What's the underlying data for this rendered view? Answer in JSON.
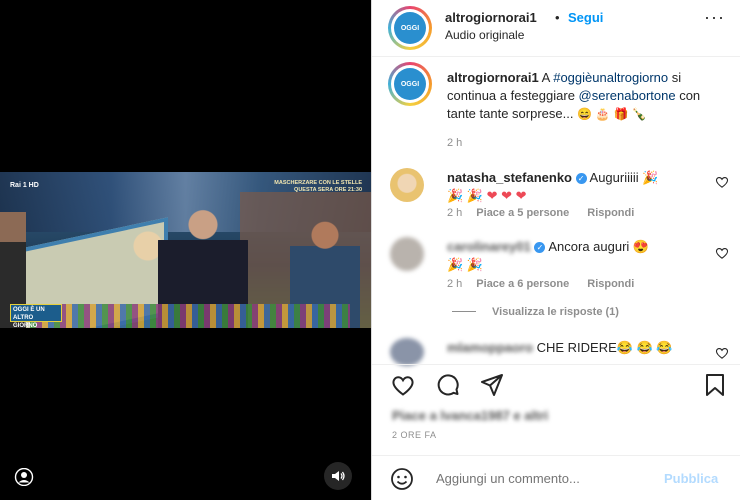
{
  "media": {
    "channel_label": "Rai 1 HD",
    "ticker_text": "MASCHERZARE CON LE STELLE QUESTA SERA ORE 21:30",
    "show_logo": "OGGI È UN ALTRO GIORNO",
    "icons": {
      "user": "user-tag-icon",
      "audio": "speaker-icon"
    }
  },
  "header": {
    "username": "altrogiornorai1",
    "separator": "•",
    "follow_label": "Segui",
    "subtitle": "Audio originale",
    "more_icon": "more-options-icon"
  },
  "caption": {
    "username": "altrogiornorai1",
    "text_a": " A ",
    "hashtag": "#oggièunaltrogiorno",
    "text_b": " si continua a festeggiare ",
    "mention": "@serenabortone",
    "text_c": " con tante tante sorprese... ",
    "emojis": "😄 🎂 🎁 🍾",
    "time": "2 h"
  },
  "comments": [
    {
      "username": "natasha_stefanenko",
      "verified": true,
      "text": "Auguriiiii 🎉",
      "text2": "🎉 🎉 ❤ ❤ ❤",
      "time": "2 h",
      "likes": "Piace a 5 persone",
      "reply": "Rispondi"
    },
    {
      "username": "carolinarey01",
      "verified": true,
      "text": "Ancora auguri 😍",
      "text2": "🎉 🎉",
      "time": "2 h",
      "likes": "Piace a 6 persone",
      "reply": "Rispondi",
      "view_replies": "Visualizza le risposte (1)"
    },
    {
      "username": "mlamoppaoro",
      "verified": false,
      "text": "CHE RIDERE😂 😂 😂"
    }
  ],
  "actions": {
    "like": "heart-icon",
    "comment": "comment-icon",
    "share": "share-icon",
    "save": "bookmark-icon"
  },
  "likes_text": "Piace a lvanca1987 e altri",
  "date": "2 ORE FA",
  "add_comment": {
    "placeholder": "Aggiungi un commento...",
    "post_label": "Pubblica",
    "emoji_icon": "emoji-smile-icon"
  },
  "colors": {
    "link": "#0095f6",
    "mention": "#00376b",
    "muted": "#8e8e8e",
    "heart": "#ed4956"
  }
}
